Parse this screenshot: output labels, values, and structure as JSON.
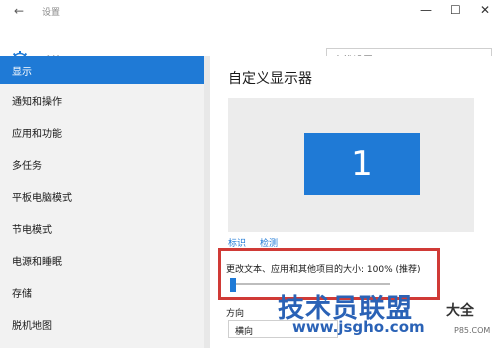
{
  "window": {
    "back_icon": "back-arrow-icon",
    "title": "设置",
    "controls": [
      "—",
      "☐",
      "✕"
    ]
  },
  "header": {
    "app_icon": "gear-icon",
    "app_title": "系统",
    "search_placeholder": "查找设置"
  },
  "sidebar": {
    "items": [
      {
        "label": "显示",
        "selected": true
      },
      {
        "label": "通知和操作",
        "selected": false
      },
      {
        "label": "应用和功能",
        "selected": false
      },
      {
        "label": "多任务",
        "selected": false
      },
      {
        "label": "平板电脑模式",
        "selected": false
      },
      {
        "label": "节电模式",
        "selected": false
      },
      {
        "label": "电源和睡眠",
        "selected": false
      },
      {
        "label": "存储",
        "selected": false
      },
      {
        "label": "脱机地图",
        "selected": false
      }
    ]
  },
  "main": {
    "title": "自定义显示器",
    "monitor_number": "1",
    "links": {
      "identify": "标识",
      "detect": "检测"
    },
    "scale_label": "更改文本、应用和其他项目的大小: 100% (推荐)",
    "scale_slider_fraction": 0.0,
    "orientation_label": "方向",
    "orientation_value": "横向"
  },
  "watermark": {
    "brand": "技术员联盟",
    "url": "www.jsgho.com",
    "extra": "大全",
    "small": "P85.COM"
  },
  "colors": {
    "accent": "#1f7ad6",
    "sidebar_bg": "#f2f2f2",
    "highlight_box": "#d03a36",
    "watermark": "#2a62b6"
  }
}
